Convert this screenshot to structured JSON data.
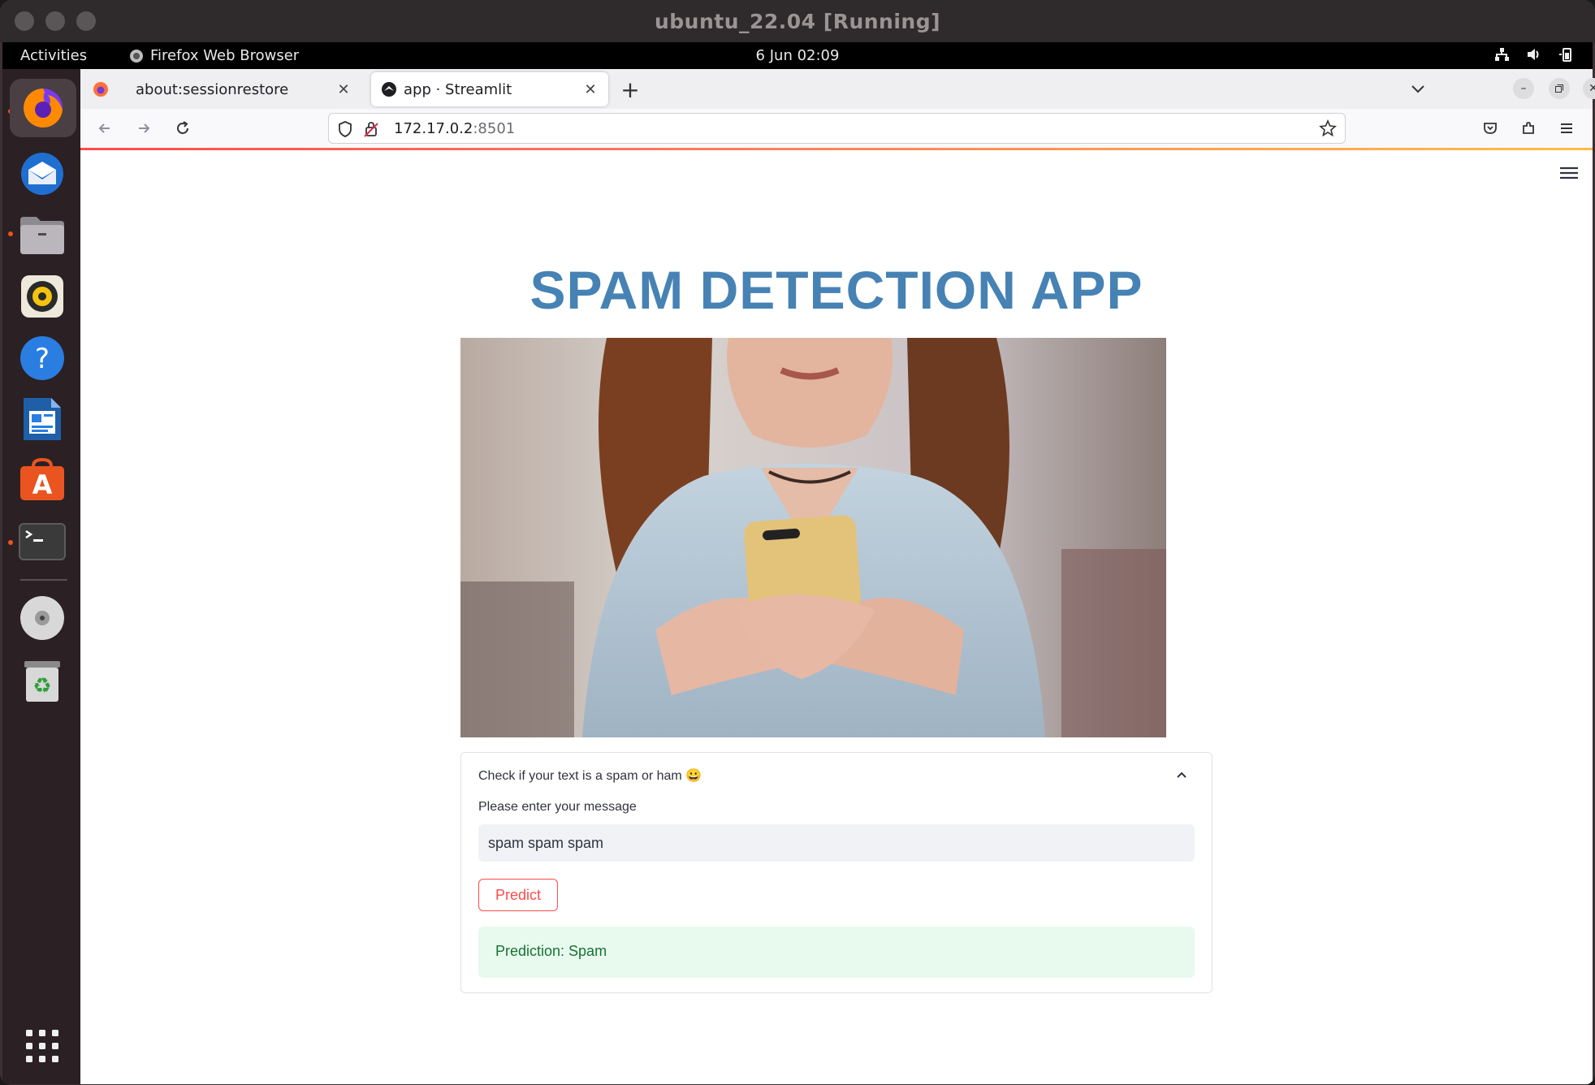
{
  "vm": {
    "title": "ubuntu_22.04 [Running]"
  },
  "topbar": {
    "activities": "Activities",
    "app_name": "Firefox Web Browser",
    "clock": "6 Jun  02:09"
  },
  "dock": {
    "items": [
      "firefox-icon",
      "thunderbird-icon",
      "files-icon",
      "rhythmbox-icon",
      "help-icon",
      "writer-icon",
      "software-icon",
      "terminal-icon",
      "disc-icon",
      "trash-icon",
      "app-grid-icon"
    ]
  },
  "browser": {
    "tabs": [
      {
        "label": "about:sessionrestore"
      },
      {
        "label": "app · Streamlit"
      }
    ],
    "url_host": "172.17.0.2",
    "url_port": ":8501"
  },
  "app": {
    "title": "SPAM DETECTION APP",
    "expander_header": "Check if your text is a spam or ham 😀",
    "input_label": "Please enter your message",
    "input_value": "spam spam spam",
    "predict_label": "Predict",
    "result_text": "Prediction: Spam"
  },
  "colors": {
    "title": "#4682b4",
    "accent": "#ff4b4b",
    "success_bg": "#e8f9ee",
    "success_text": "#177233"
  }
}
